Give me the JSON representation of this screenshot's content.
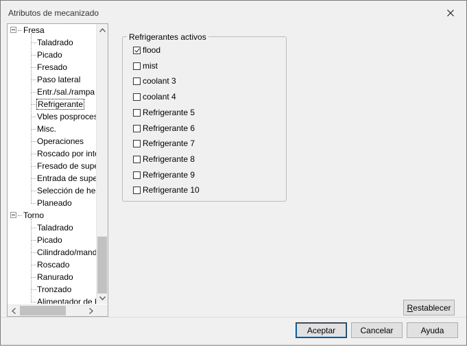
{
  "window": {
    "title": "Atributos de mecanizado"
  },
  "tree": {
    "roots": [
      {
        "label": "Fresa",
        "children": [
          "Taladrado",
          "Picado",
          "Fresado",
          "Paso lateral",
          "Entr./sal./rampa",
          "Refrigerante",
          "Vbles posprocesador",
          "Misc.",
          "Operaciones",
          "Roscado por interpolación",
          "Fresado de superficie",
          "Entrada de superficie",
          "Selección de herramienta",
          "Planeado"
        ]
      },
      {
        "label": "Torno",
        "children": [
          "Taladrado",
          "Picado",
          "Cilindrado/mandrinado",
          "Roscado",
          "Ranurado",
          "Tronzado",
          "Alimentador de barra"
        ]
      }
    ],
    "selected": "Refrigerante"
  },
  "coolants": {
    "legend": "Refrigerantes activos",
    "items": [
      {
        "label": "flood",
        "checked": true
      },
      {
        "label": "mist",
        "checked": false
      },
      {
        "label": "coolant 3",
        "checked": false
      },
      {
        "label": "coolant 4",
        "checked": false
      },
      {
        "label": "Refrigerante 5",
        "checked": false
      },
      {
        "label": "Refrigerante 6",
        "checked": false
      },
      {
        "label": "Refrigerante 7",
        "checked": false
      },
      {
        "label": "Refrigerante 8",
        "checked": false
      },
      {
        "label": "Refrigerante 9",
        "checked": false
      },
      {
        "label": "Refrigerante 10",
        "checked": false
      }
    ]
  },
  "buttons": {
    "reset_mnemonic": "R",
    "reset_rest": "establecer",
    "accept": "Aceptar",
    "cancel": "Cancelar",
    "help": "Ayuda"
  }
}
